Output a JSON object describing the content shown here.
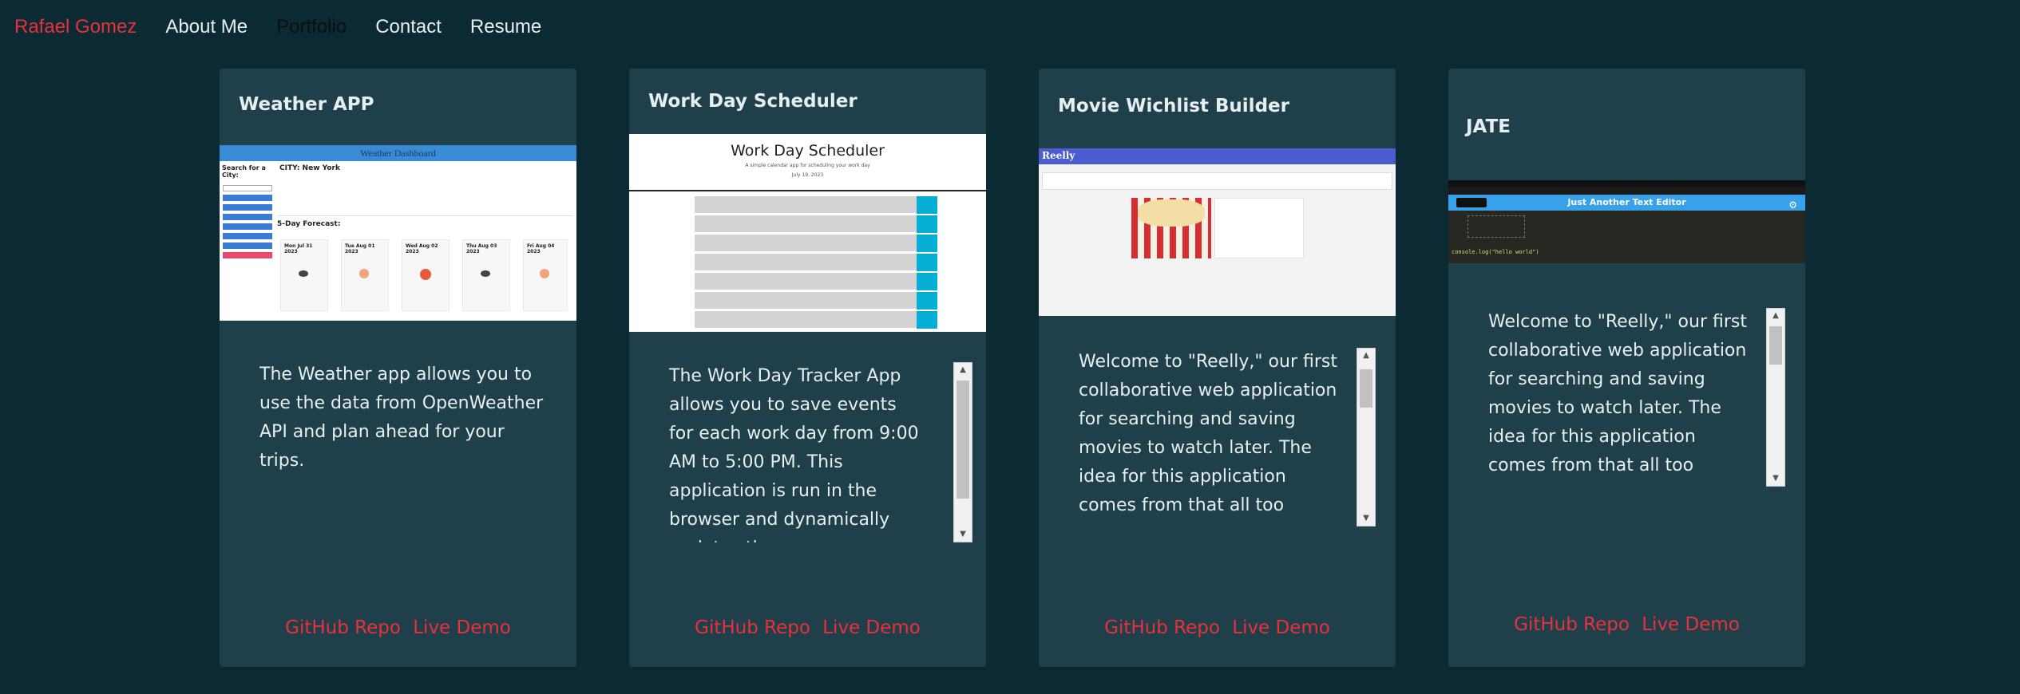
{
  "nav": {
    "brand": "Rafael Gomez",
    "items": [
      "About Me",
      "Portfolio",
      "Contact",
      "Resume"
    ]
  },
  "cards": [
    {
      "title": "Weather APP",
      "description": "The Weather app allows you to use the data from OpenWeather API and plan ahead for your trips.",
      "github": "GitHub Repo",
      "demo": "Live Demo",
      "shot": {
        "header": "Weather Dashboard",
        "search_label": "Search for a City:",
        "city": "CITY: New York",
        "forecast_title": "5-Day Forecast:",
        "days": [
          "Mon Jul 31 2023",
          "Tue Aug 01 2023",
          "Wed Aug 02 2023",
          "Thu Aug 03 2023",
          "Fri Aug 04 2023"
        ]
      }
    },
    {
      "title": "Work Day Scheduler",
      "description": "The Work Day Tracker App allows you to save events for each work day from 9:00 AM to 5:00 PM. This application is run in the browser and dynamically updates the",
      "github": "GitHub Repo",
      "demo": "Live Demo",
      "shot": {
        "header": "Work Day Scheduler",
        "subtitle": "A simple calendar app for scheduling your work day",
        "date": "July 19, 2023"
      }
    },
    {
      "title": "Movie Wichlist Builder",
      "description": "Welcome to \"Reelly,\" our first collaborative web application for searching and saving movies to watch later. The idea for this application comes from that all too",
      "github": "GitHub Repo",
      "demo": "Live Demo",
      "shot": {
        "logo": "Reelly"
      }
    },
    {
      "title": "JATE",
      "description": "Welcome to \"Reelly,\" our first collaborative web application for searching and saving movies to watch later. The idea for this application comes from that all too",
      "github": "GitHub Repo",
      "demo": "Live Demo",
      "shot": {
        "bar_title": "Just Another Text Editor",
        "code": "console.log(\"hello world\")"
      }
    }
  ],
  "colors": {
    "background": "#0b2a34",
    "card": "#1f3f4a",
    "accent": "#e8313b"
  }
}
